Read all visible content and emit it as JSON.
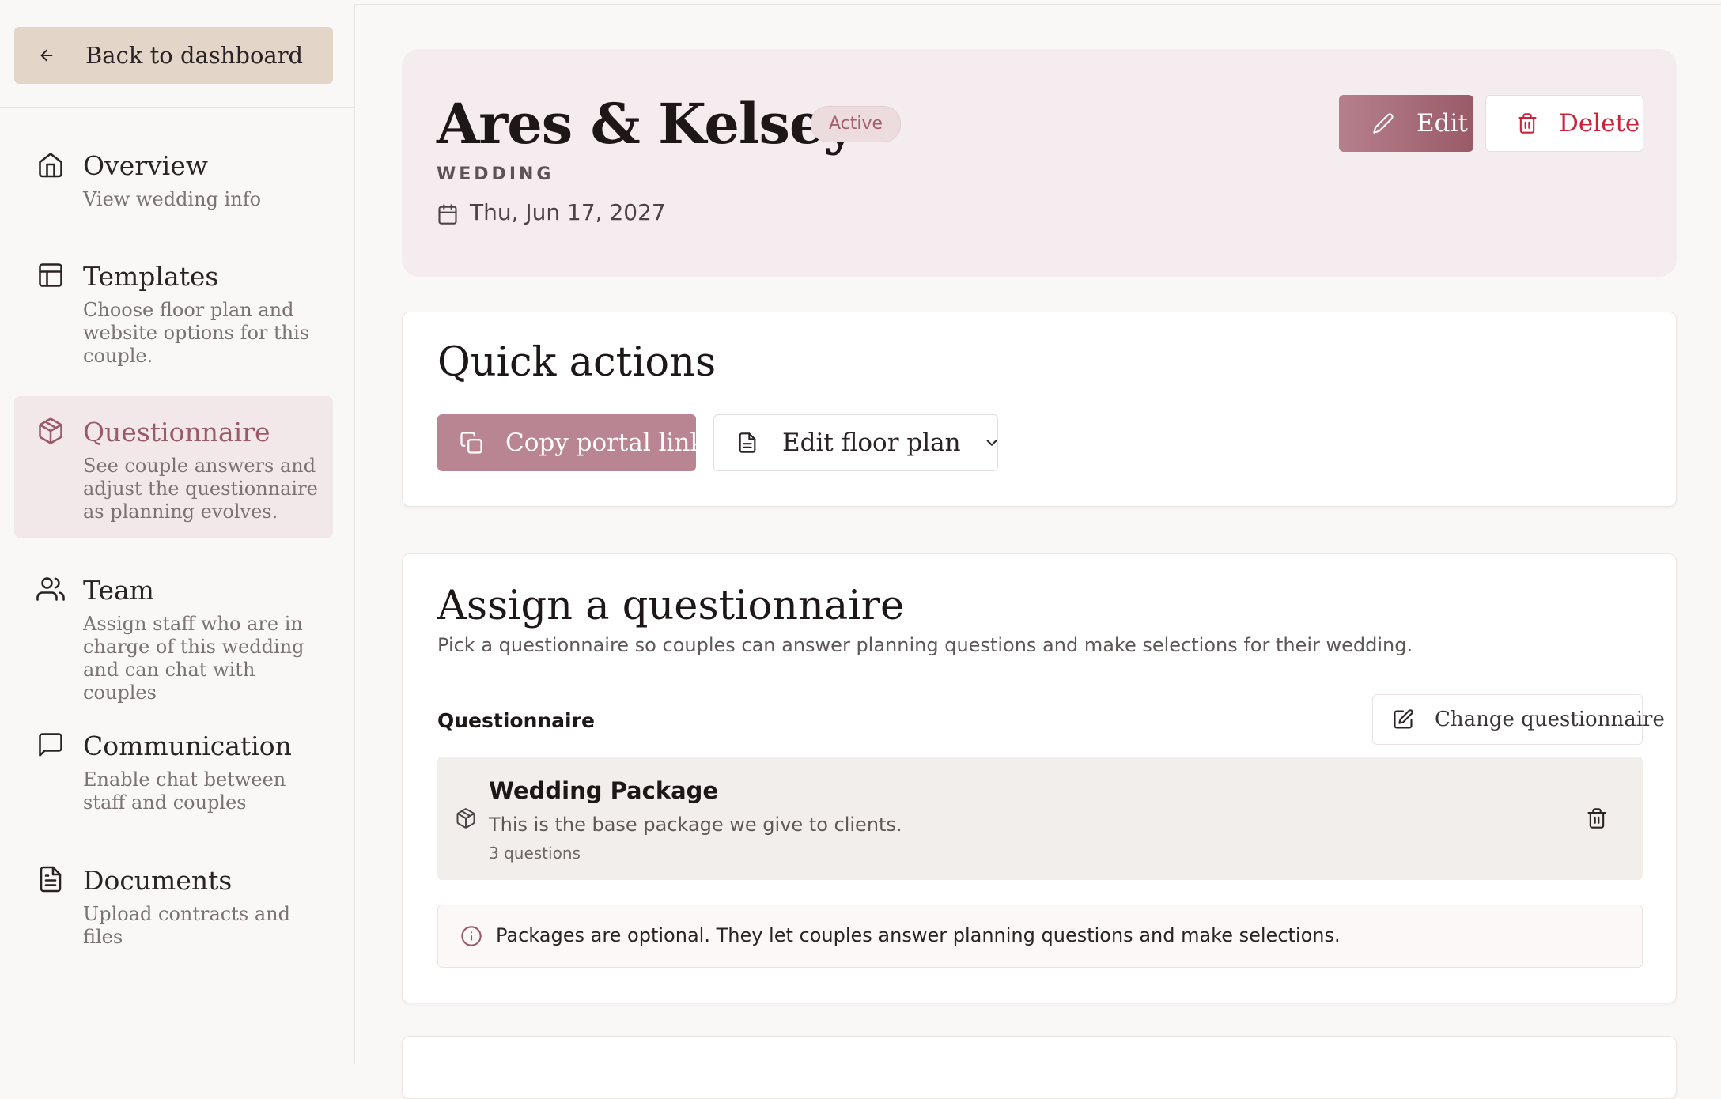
{
  "sidebar": {
    "back_label": "Back to dashboard",
    "items": [
      {
        "title": "Overview",
        "desc": "View wedding info",
        "icon": "home-icon"
      },
      {
        "title": "Templates",
        "desc": "Choose floor plan and website options for this couple.",
        "icon": "layout-icon"
      },
      {
        "title": "Questionnaire",
        "desc": "See couple answers and adjust the questionnaire as planning evolves.",
        "icon": "package-icon",
        "active": true
      },
      {
        "title": "Team",
        "desc": "Assign staff who are in charge of this wedding and can chat with couples",
        "icon": "users-icon"
      },
      {
        "title": "Communication",
        "desc": "Enable chat between staff and couples",
        "icon": "message-square-icon"
      },
      {
        "title": "Documents",
        "desc": "Upload contracts and files",
        "icon": "file-text-icon"
      }
    ]
  },
  "event": {
    "name": "Ares & Kelsey",
    "status": "Active",
    "type": "WEDDING",
    "date": "Thu, Jun 17, 2027",
    "edit_label": "Edit",
    "delete_label": "Delete"
  },
  "quick_actions": {
    "title": "Quick actions",
    "copy_label": "Copy portal link",
    "floor_label": "Edit floor plan"
  },
  "assign": {
    "title": "Assign a questionnaire",
    "subtitle": "Pick a questionnaire so couples can answer planning questions and make selections for their wedding.",
    "field_label": "Questionnaire",
    "change_label": "Change questionnaire",
    "package": {
      "name": "Wedding Package",
      "description": "This is the base package we give to clients.",
      "count": "3 questions"
    },
    "note": "Packages are optional. They let couples answer planning questions and make selections."
  },
  "colors": {
    "accent": "#9a5a68",
    "accent_light": "#ba8592",
    "danger": "#c8243a",
    "back_button": "#e3d6c8",
    "hero_bg": "#f4ecee"
  }
}
